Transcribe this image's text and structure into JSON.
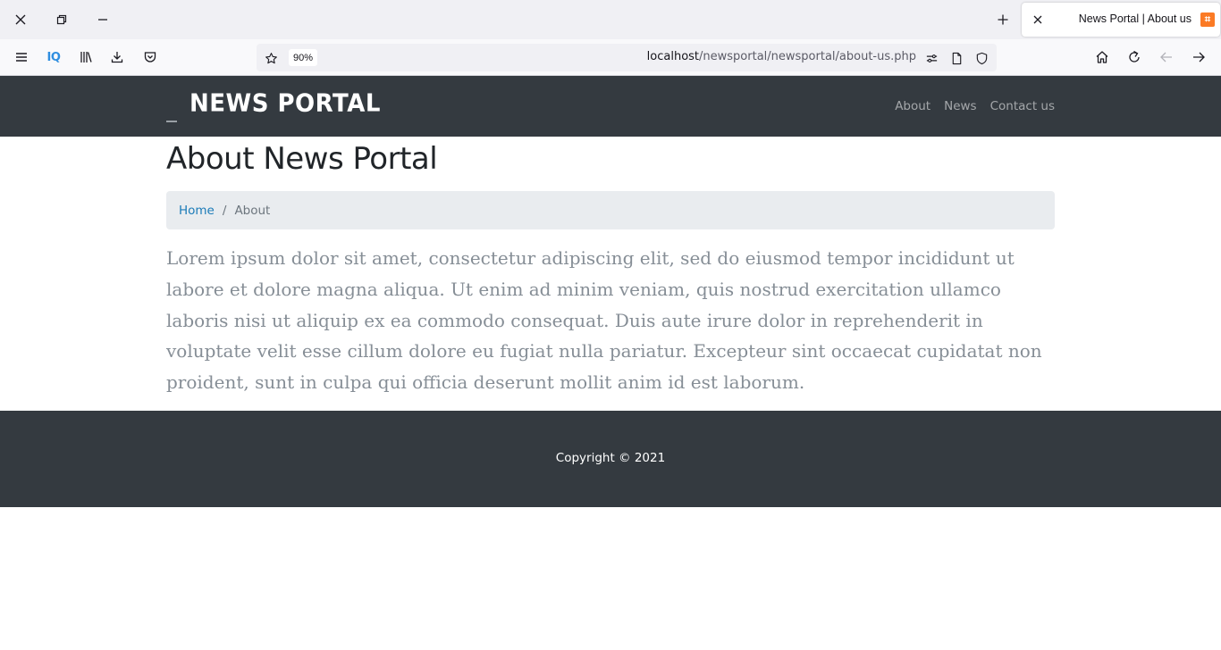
{
  "browser": {
    "tab": {
      "title": "News Portal | About us"
    },
    "url": {
      "host": "localhost",
      "path": "/newsportal/newsportal/about-us.php"
    },
    "zoom": "90%",
    "toolbar_text": {
      "iq": "IQ"
    },
    "icons": [
      "close-icon",
      "restore-icon",
      "minimize-icon",
      "new-tab-icon",
      "menu-icon",
      "library-icon",
      "downloads-icon",
      "pocket-icon",
      "bookmark-star-icon",
      "permissions-icon",
      "reader-view-icon",
      "shield-icon",
      "home-icon",
      "reload-icon",
      "back-icon",
      "forward-icon"
    ]
  },
  "site": {
    "brand": "NEWS PORTAL",
    "nav": [
      "About",
      "News",
      "Contact us"
    ],
    "page_title": "About News Portal",
    "breadcrumb": {
      "home": "Home",
      "separator": "/",
      "current": "About"
    },
    "body_text": "Lorem ipsum dolor sit amet, consectetur adipiscing elit, sed do eiusmod tempor incididunt ut labore et dolore magna aliqua. Ut enim ad minim veniam, quis nostrud exercitation ullamco laboris nisi ut aliquip ex ea commodo consequat. Duis aute irure dolor in reprehenderit in voluptate velit esse cillum dolore eu fugiat nulla pariatur. Excepteur sint occaecat cupidatat non proident, sunt in culpa qui officia deserunt mollit anim id est laborum.",
    "footer": "Copyright © 2021"
  },
  "colors": {
    "nav_bg": "#343a40",
    "breadcrumb_bg": "#e9ecef",
    "link": "#1b7bb8",
    "body_text": "#868e96"
  }
}
